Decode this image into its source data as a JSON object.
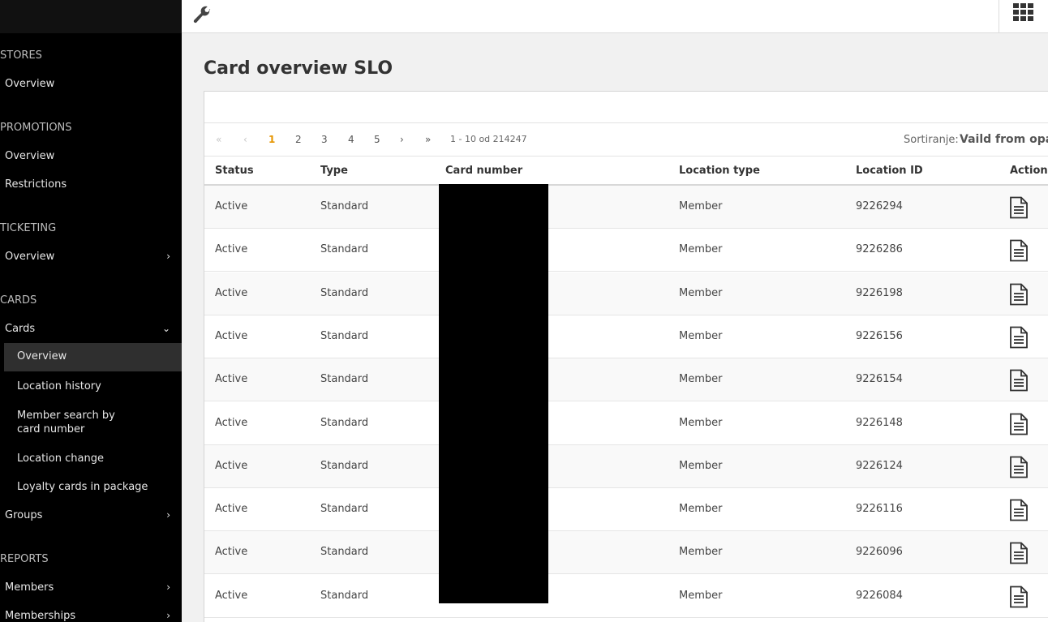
{
  "sidebar": {
    "sections": [
      {
        "title": "STORES"
      },
      {
        "title": "PROMOTIONS"
      },
      {
        "title": "TICKETING"
      },
      {
        "title": "CARDS"
      },
      {
        "title": "REPORTS"
      }
    ],
    "stores_overview": "Overview",
    "promotions_overview": "Overview",
    "promotions_restrictions": "Restrictions",
    "ticketing_overview": "Overview",
    "cards": "Cards",
    "cards_sub": [
      "Overview",
      "Location history",
      "Member search by card number",
      "Location change",
      "Loyalty cards in package"
    ],
    "groups": "Groups",
    "members": "Members",
    "memberships": "Memberships"
  },
  "page": {
    "title": "Card overview SLO"
  },
  "pager": {
    "first": "«",
    "prev": "‹",
    "pages": [
      "1",
      "2",
      "3",
      "4",
      "5"
    ],
    "next": "›",
    "last": "»",
    "info": "1 - 10 od 214247",
    "sort_label": "Sortiranje:",
    "sort_value": "Vaild from opada"
  },
  "table": {
    "headers": [
      "Status",
      "Type",
      "Card number",
      "Location type",
      "Location ID",
      "Action"
    ],
    "rows": [
      {
        "status": "Active",
        "type": "Standard",
        "location_type": "Member",
        "location_id": "9226294"
      },
      {
        "status": "Active",
        "type": "Standard",
        "location_type": "Member",
        "location_id": "9226286"
      },
      {
        "status": "Active",
        "type": "Standard",
        "location_type": "Member",
        "location_id": "9226198"
      },
      {
        "status": "Active",
        "type": "Standard",
        "location_type": "Member",
        "location_id": "9226156"
      },
      {
        "status": "Active",
        "type": "Standard",
        "location_type": "Member",
        "location_id": "9226154"
      },
      {
        "status": "Active",
        "type": "Standard",
        "location_type": "Member",
        "location_id": "9226148"
      },
      {
        "status": "Active",
        "type": "Standard",
        "location_type": "Member",
        "location_id": "9226124"
      },
      {
        "status": "Active",
        "type": "Standard",
        "location_type": "Member",
        "location_id": "9226116"
      },
      {
        "status": "Active",
        "type": "Standard",
        "location_type": "Member",
        "location_id": "9226096"
      },
      {
        "status": "Active",
        "type": "Standard",
        "location_type": "Member",
        "location_id": "9226084"
      }
    ]
  },
  "colors": {
    "sidebar_bg": "#000000",
    "active_page": "#e69500",
    "active_nav": "#2f2f2f"
  },
  "icons": {
    "topbar_left": "wrench-icon",
    "topbar_right": "apps-grid-icon",
    "action": "document-icon"
  }
}
